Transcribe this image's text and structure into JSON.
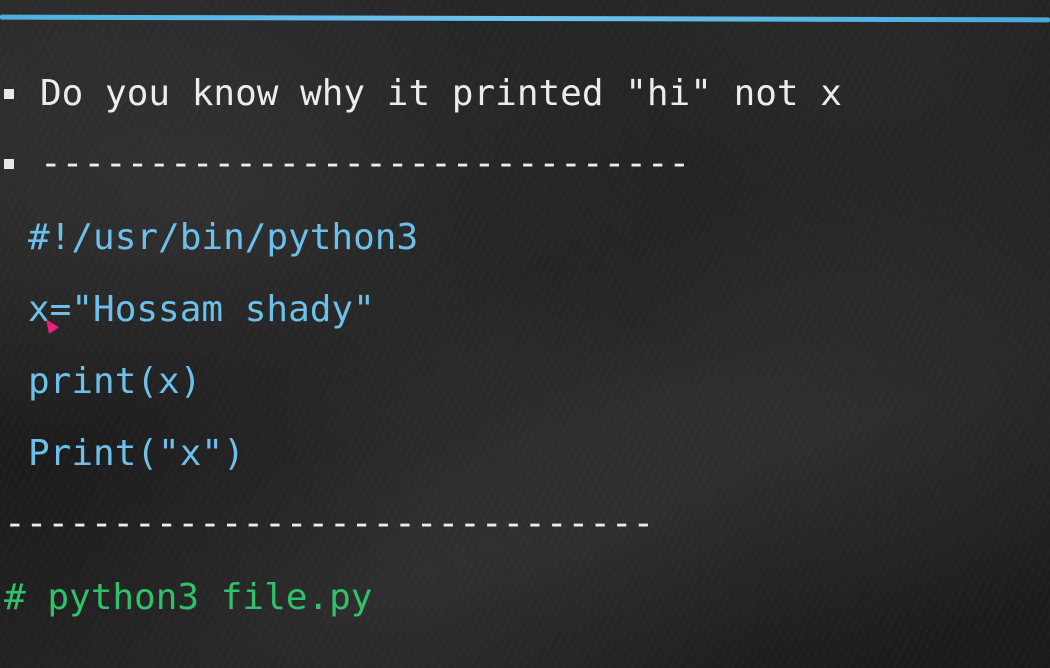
{
  "slide": {
    "bullets": [
      {
        "text": "Do you know why it printed \"hi\" not x"
      },
      {
        "text": "------------------------------"
      }
    ],
    "code_lines": [
      "#!/usr/bin/python3",
      "x=\"Hossam shady\"",
      "print(x)",
      "Print(\"x\")"
    ],
    "separator": "------------------------------",
    "command": "# python3 file.py"
  },
  "colors": {
    "background": "#1e1e1e",
    "accent_rule": "#4fb0e0",
    "bullet_text": "#ececec",
    "code_text": "#6cc0ea",
    "command_text": "#2fc26a",
    "cursor": "#e8207a"
  },
  "icons": {
    "bullet": "square-bullet-icon",
    "pointer": "mouse-cursor-icon"
  }
}
